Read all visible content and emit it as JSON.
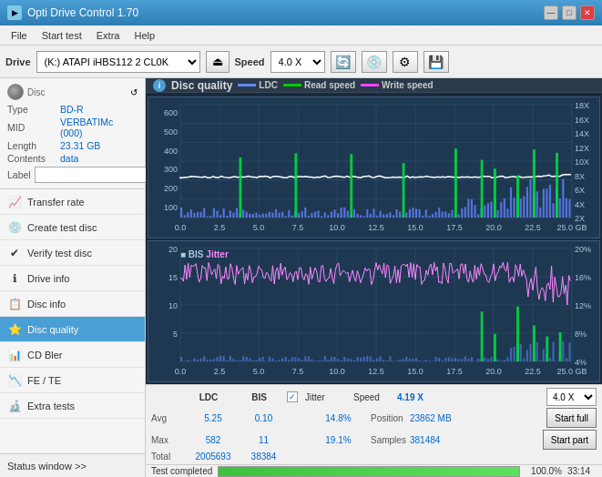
{
  "titleBar": {
    "title": "Opti Drive Control 1.70",
    "minimize": "—",
    "maximize": "□",
    "close": "✕"
  },
  "menuBar": {
    "items": [
      "File",
      "Start test",
      "Extra",
      "Help"
    ]
  },
  "driveBar": {
    "driveLabel": "Drive",
    "driveValue": "(K:)  ATAPI iHBS112  2 CL0K",
    "speedLabel": "Speed",
    "speedValue": "4.0 X"
  },
  "disc": {
    "typeLabel": "Type",
    "typeValue": "BD-R",
    "midLabel": "MID",
    "midValue": "VERBATIMc (000)",
    "lengthLabel": "Length",
    "lengthValue": "23.31 GB",
    "contentsLabel": "Contents",
    "contentsValue": "data",
    "labelLabel": "Label",
    "labelValue": ""
  },
  "navItems": [
    {
      "id": "transfer-rate",
      "label": "Transfer rate",
      "icon": "📈"
    },
    {
      "id": "create-test-disc",
      "label": "Create test disc",
      "icon": "💿"
    },
    {
      "id": "verify-test-disc",
      "label": "Verify test disc",
      "icon": "✔"
    },
    {
      "id": "drive-info",
      "label": "Drive info",
      "icon": "ℹ"
    },
    {
      "id": "disc-info",
      "label": "Disc info",
      "icon": "📋"
    },
    {
      "id": "disc-quality",
      "label": "Disc quality",
      "icon": "⭐",
      "active": true
    },
    {
      "id": "cd-bler",
      "label": "CD Bler",
      "icon": "📊"
    },
    {
      "id": "fe-te",
      "label": "FE / TE",
      "icon": "📉"
    },
    {
      "id": "extra-tests",
      "label": "Extra tests",
      "icon": "🔬"
    }
  ],
  "statusWindow": "Status window >>",
  "chartTitle": "Disc quality",
  "legend": [
    {
      "label": "LDC",
      "color": "#0000ff"
    },
    {
      "label": "Read speed",
      "color": "#00ff00"
    },
    {
      "label": "Write speed",
      "color": "#ff00ff"
    }
  ],
  "legend2": [
    {
      "label": "BIS",
      "color": "#0000ff"
    },
    {
      "label": "Jitter",
      "color": "#ff88ff"
    }
  ],
  "chart1": {
    "yMax": 600,
    "yLabelsRight": [
      "18X",
      "16X",
      "14X",
      "12X",
      "10X",
      "8X",
      "6X",
      "4X",
      "2X"
    ],
    "yLabelsLeft": [
      "600",
      "500",
      "400",
      "300",
      "200",
      "100"
    ],
    "xLabels": [
      "0.0",
      "2.5",
      "5.0",
      "7.5",
      "10.0",
      "12.5",
      "15.0",
      "17.5",
      "20.0",
      "22.5",
      "25.0 GB"
    ]
  },
  "chart2": {
    "yMax": 20,
    "yLabelsRight": [
      "20%",
      "16%",
      "12%",
      "8%",
      "4%"
    ],
    "yLabelsLeft": [
      "20",
      "15",
      "10",
      "5"
    ],
    "xLabels": [
      "0.0",
      "2.5",
      "5.0",
      "7.5",
      "10.0",
      "12.5",
      "15.0",
      "17.5",
      "20.0",
      "22.5",
      "25.0 GB"
    ]
  },
  "stats": {
    "headers": [
      "LDC",
      "BIS",
      "",
      "Jitter",
      "Speed"
    ],
    "avg": {
      "ldc": "5.25",
      "bis": "0.10",
      "jitter": "14.8%"
    },
    "max": {
      "ldc": "582",
      "bis": "11",
      "jitter": "19.1%"
    },
    "total": {
      "ldc": "2005693",
      "bis": "38384"
    },
    "speed": {
      "value": "4.19 X",
      "select": "4.0 X"
    },
    "position": {
      "label": "Position",
      "value": "23862 MB"
    },
    "samples": {
      "label": "Samples",
      "value": "381484"
    },
    "startFull": "Start full",
    "startPart": "Start part"
  },
  "progressBar": {
    "percent": 100,
    "percentText": "100.0%",
    "time": "33:14",
    "statusText": "Test completed"
  }
}
